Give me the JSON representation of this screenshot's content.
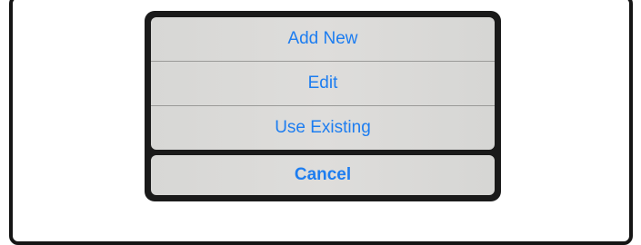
{
  "action_sheet": {
    "actions": [
      {
        "label": "Add New"
      },
      {
        "label": "Edit"
      },
      {
        "label": "Use Existing"
      }
    ],
    "cancel_label": "Cancel",
    "accent_color": "#1d7df0"
  }
}
